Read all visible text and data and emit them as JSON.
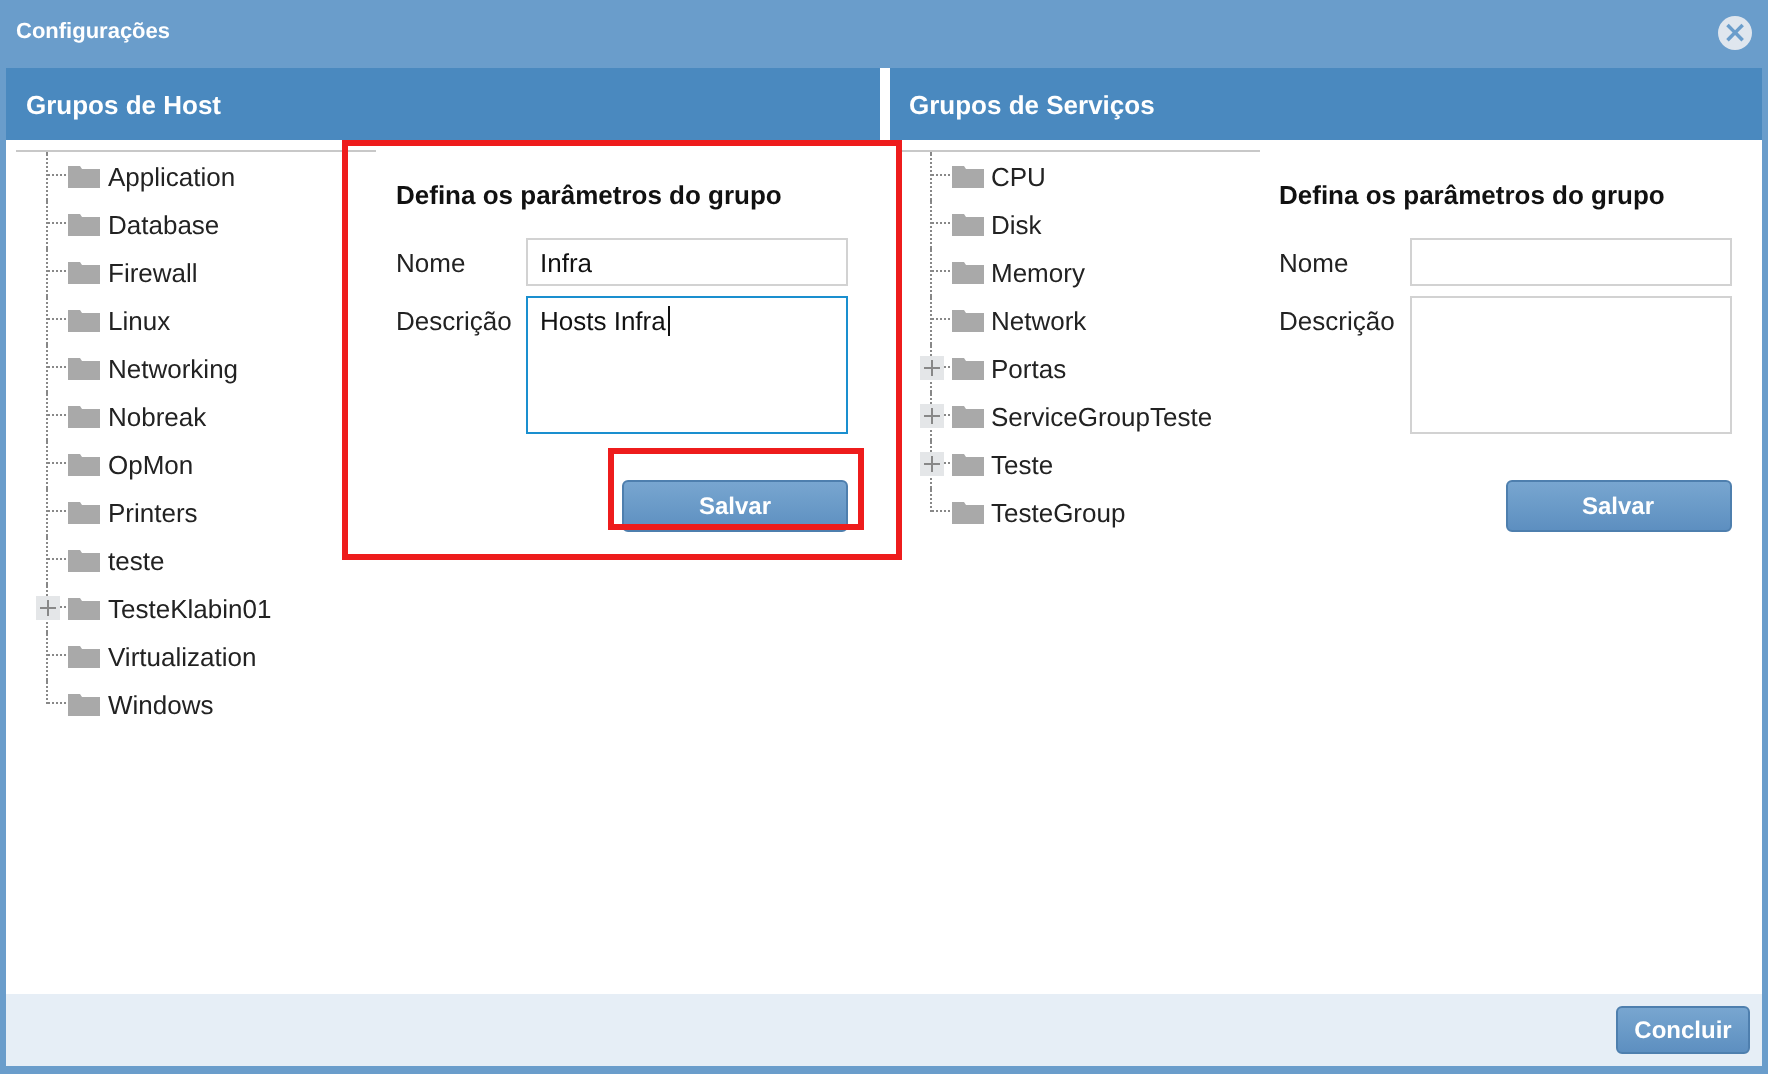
{
  "window": {
    "title": "Configurações",
    "close": "×"
  },
  "panels": [
    {
      "title": "Grupos de Host",
      "tree": [
        {
          "label": "Application",
          "expandable": false
        },
        {
          "label": "Database",
          "expandable": false
        },
        {
          "label": "Firewall",
          "expandable": false
        },
        {
          "label": "Linux",
          "expandable": false
        },
        {
          "label": "Networking",
          "expandable": false
        },
        {
          "label": "Nobreak",
          "expandable": false
        },
        {
          "label": "OpMon",
          "expandable": false
        },
        {
          "label": "Printers",
          "expandable": false
        },
        {
          "label": "teste",
          "expandable": false
        },
        {
          "label": "TesteKlabin01",
          "expandable": true
        },
        {
          "label": "Virtualization",
          "expandable": false
        },
        {
          "label": "Windows",
          "expandable": false
        }
      ],
      "form": {
        "heading": "Defina os parâmetros do grupo",
        "name_label": "Nome",
        "name_value": "Infra",
        "description_label": "Descrição",
        "description_value": "Hosts Infra",
        "description_focused": true,
        "highlighted": true,
        "button": "Salvar",
        "button_highlighted": true
      }
    },
    {
      "title": "Grupos de Serviços",
      "tree": [
        {
          "label": "CPU",
          "expandable": false
        },
        {
          "label": "Disk",
          "expandable": false
        },
        {
          "label": "Memory",
          "expandable": false
        },
        {
          "label": "Network",
          "expandable": false
        },
        {
          "label": "Portas",
          "expandable": true
        },
        {
          "label": "ServiceGroupTeste",
          "expandable": true
        },
        {
          "label": "Teste",
          "expandable": true
        },
        {
          "label": "TesteGroup",
          "expandable": false
        }
      ],
      "form": {
        "heading": "Defina os parâmetros do grupo",
        "name_label": "Nome",
        "description_label": "Descrição",
        "description_focused": false,
        "highlighted": false,
        "button": "Salvar",
        "button_highlighted": false
      }
    }
  ],
  "footer": {
    "button": "Concluir"
  }
}
